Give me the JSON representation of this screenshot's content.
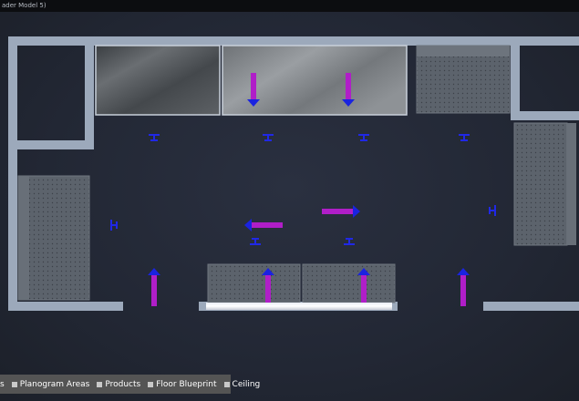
{
  "window": {
    "title": "ader Model 5)"
  },
  "viewport": {
    "colors": {
      "wall": "#9ca9bb",
      "fixture": "#5f6670",
      "arrow_shaft": "#b01ec8",
      "arrow_head": "#1a23e0",
      "marker": "#2028e6",
      "light": "#ffffff"
    }
  },
  "toolbar": {
    "toggles": [
      {
        "label": "s"
      },
      {
        "label": "Planogram Areas"
      },
      {
        "label": "Products"
      },
      {
        "label": "Floor Blueprint"
      },
      {
        "label": "Ceiling"
      }
    ]
  }
}
